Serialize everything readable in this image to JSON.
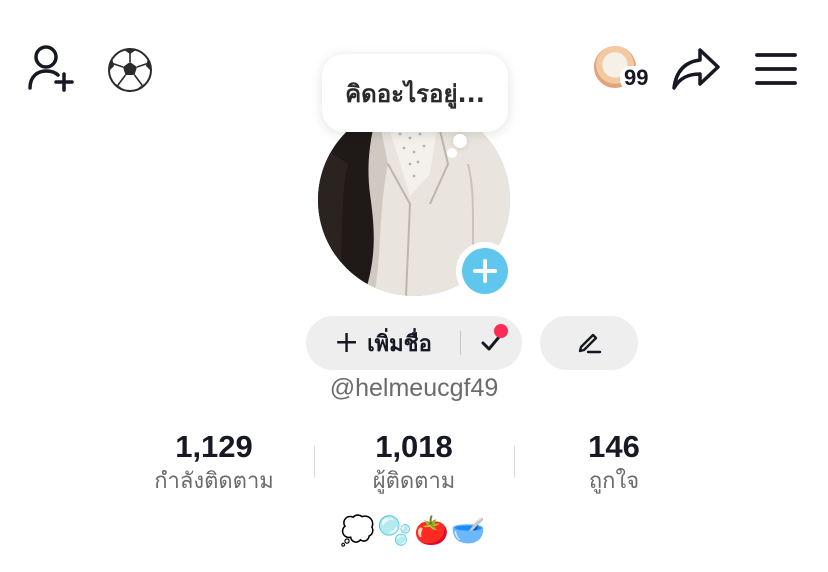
{
  "header": {
    "icons": [
      "add-user-icon",
      "soccer-ball-icon",
      "notification-avatar",
      "share-icon",
      "menu-icon"
    ],
    "notification_count": "99"
  },
  "note_bubble": {
    "text": "คิดอะไรอยู่..."
  },
  "profile": {
    "name_button_label": "เพิ่มชื่อ",
    "username": "@helmeucgf49",
    "bio_emojis": "💭🫧🍅🥣"
  },
  "stats": [
    {
      "value": "1,129",
      "label": "กำลังติดตาม"
    },
    {
      "value": "1,018",
      "label": "ผู้ติดตาม"
    },
    {
      "value": "146",
      "label": "ถูกใจ"
    }
  ],
  "colors": {
    "accent_blue": "#5fc6ee",
    "badge_red": "#fe2c55",
    "button_bg": "#eeeeee",
    "text_primary": "#161823",
    "text_secondary": "#6b6b6b"
  }
}
